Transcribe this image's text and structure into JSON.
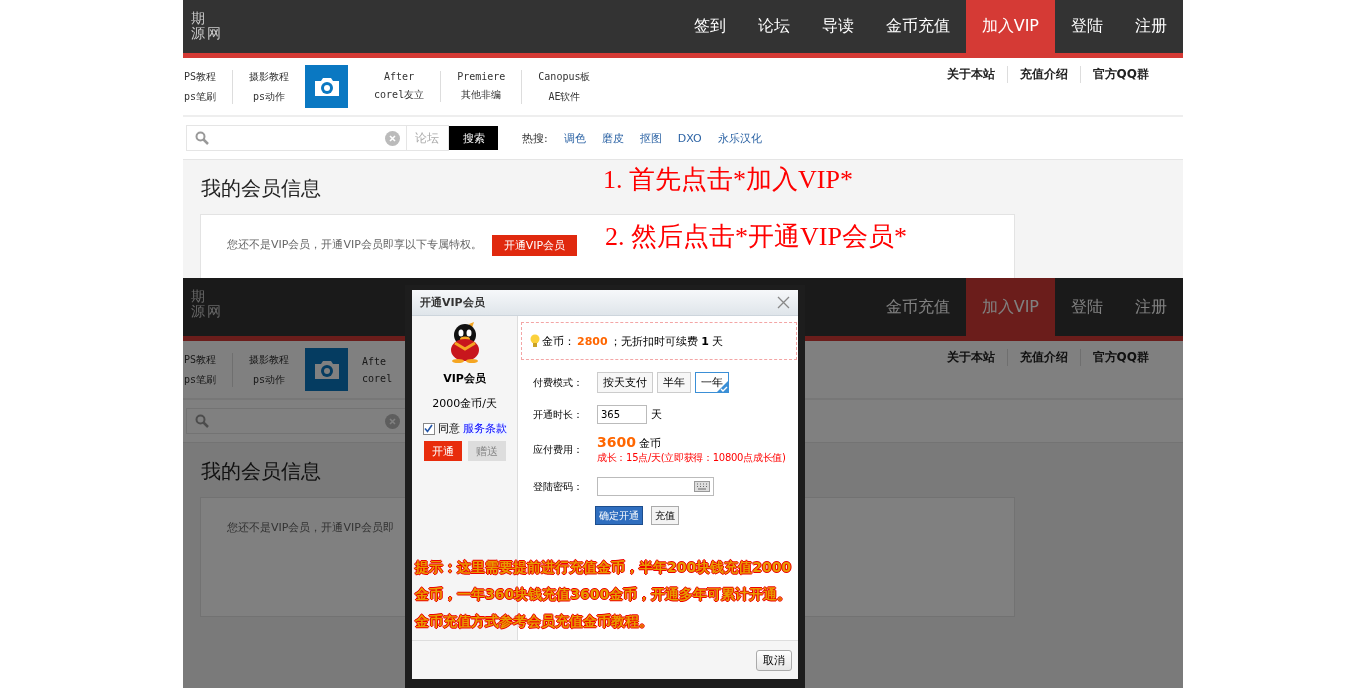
{
  "panels": [
    {
      "logo_lines": [
        "期",
        "源网"
      ],
      "nav": [
        {
          "label": "签到",
          "selected": false
        },
        {
          "label": "论坛",
          "selected": false
        },
        {
          "label": "导读",
          "selected": false
        },
        {
          "label": "金币充值",
          "selected": false
        },
        {
          "label": "加入VIP",
          "selected": true
        },
        {
          "label": "登陆",
          "selected": false
        },
        {
          "label": "注册",
          "selected": false
        }
      ],
      "categories": [
        {
          "kind": "links",
          "top": "PS教程",
          "bottom": "ps笔刷"
        },
        {
          "kind": "links",
          "top": "摄影教程",
          "bottom": "ps动作"
        },
        {
          "kind": "tile"
        },
        {
          "kind": "links",
          "top": "After",
          "bottom": "corel友立"
        },
        {
          "kind": "links",
          "top": "Premiere",
          "bottom": "其他非编"
        },
        {
          "kind": "links",
          "top": "Canopus板",
          "bottom": "AE软件"
        }
      ],
      "top_links": [
        "关于本站",
        "充值介绍",
        "官方QQ群"
      ],
      "search": {
        "scope": "论坛",
        "button": "搜索",
        "hot_label": "热搜:",
        "hot_terms": [
          "调色",
          "磨皮",
          "抠图",
          "DXO",
          "永乐汉化"
        ]
      },
      "title": "我的会员信息",
      "notice": {
        "text": "您还不是VIP会员，开通VIP会员即享以下专属特权。",
        "button": "开通VIP会员"
      },
      "annotations": [
        "1. 首先点击*加入VIP*",
        "2. 然后点击*开通VIP会员*"
      ]
    },
    {
      "logo_lines": [
        "期",
        "源网"
      ],
      "nav": [
        {
          "label": "金币充值",
          "selected": false
        },
        {
          "label": "加入VIP",
          "selected": true
        },
        {
          "label": "登陆",
          "selected": false
        },
        {
          "label": "注册",
          "selected": false
        }
      ],
      "categories": [
        {
          "kind": "links",
          "top": "PS教程",
          "bottom": "ps笔刷"
        },
        {
          "kind": "links",
          "top": "摄影教程",
          "bottom": "ps动作"
        },
        {
          "kind": "tile"
        },
        {
          "kind": "links",
          "top": "Afte",
          "bottom": "corel"
        }
      ],
      "top_links": [
        "关于本站",
        "充值介绍",
        "官方QQ群"
      ],
      "title": "我的会员信息",
      "notice": {
        "text": "您还不是VIP会员，开通VIP会员即"
      },
      "dialog": {
        "title": "开通VIP会员",
        "product": "VIP会员",
        "price": "2000金币/天",
        "agree": {
          "checked": true,
          "label": "同意",
          "link": "服务条款"
        },
        "actions": [
          {
            "label": "开通",
            "disabled": false
          },
          {
            "label": "赠送",
            "disabled": true
          }
        ],
        "balance": {
          "label": "金币：",
          "amount": "2800",
          "rest": "；无折扣时可续费 **1** 天"
        },
        "pay_mode": {
          "label": "付费模式：",
          "options": [
            {
              "label": "按天支付",
              "selected": false
            },
            {
              "label": "半年",
              "selected": false
            },
            {
              "label": "一年",
              "selected": true
            }
          ]
        },
        "duration": {
          "label": "开通时长：",
          "value": "365",
          "unit": "天"
        },
        "fee": {
          "label": "应付费用：",
          "amount": "3600",
          "unit": "金币",
          "growth": "成长：15点/天(立即获得：10800点成长值)"
        },
        "password": {
          "label": "登陆密码："
        },
        "buttons": [
          "确定开通",
          "充值"
        ],
        "note": "提示：这里需要提前进行充值金币，半年200块钱充值2000金币，一年360块钱充值3600金币，开通多年可累计开通。金币充值方式参考会员充值金币教程。",
        "cancel": "取消"
      }
    }
  ]
}
